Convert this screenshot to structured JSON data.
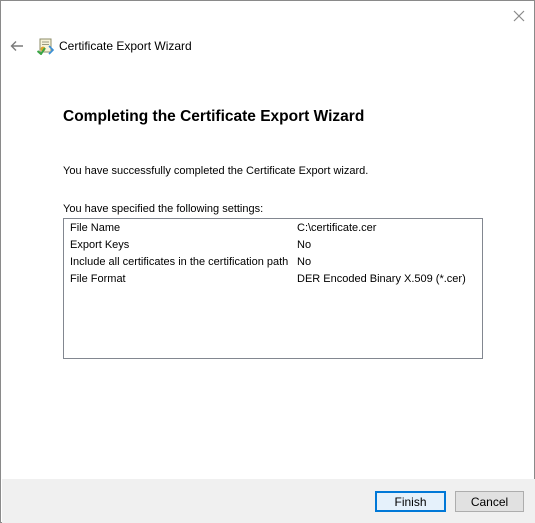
{
  "window": {
    "title": "Certificate Export Wizard"
  },
  "page": {
    "heading": "Completing the Certificate Export Wizard",
    "intro": "You have successfully completed the Certificate Export wizard.",
    "settings_label": "You have specified the following settings:",
    "settings": [
      {
        "key": "File Name",
        "value": "C:\\certificate.cer"
      },
      {
        "key": "Export Keys",
        "value": "No"
      },
      {
        "key": "Include all certificates in the certification path",
        "value": "No"
      },
      {
        "key": "File Format",
        "value": "DER Encoded Binary X.509 (*.cer)"
      }
    ]
  },
  "buttons": {
    "finish": "Finish",
    "cancel": "Cancel"
  },
  "icons": {
    "close": "close-icon",
    "back": "back-arrow-icon",
    "wizard": "certificate-wizard-icon"
  },
  "colors": {
    "default_button_border": "#0078d7",
    "footer_background": "#f0f0f0"
  }
}
